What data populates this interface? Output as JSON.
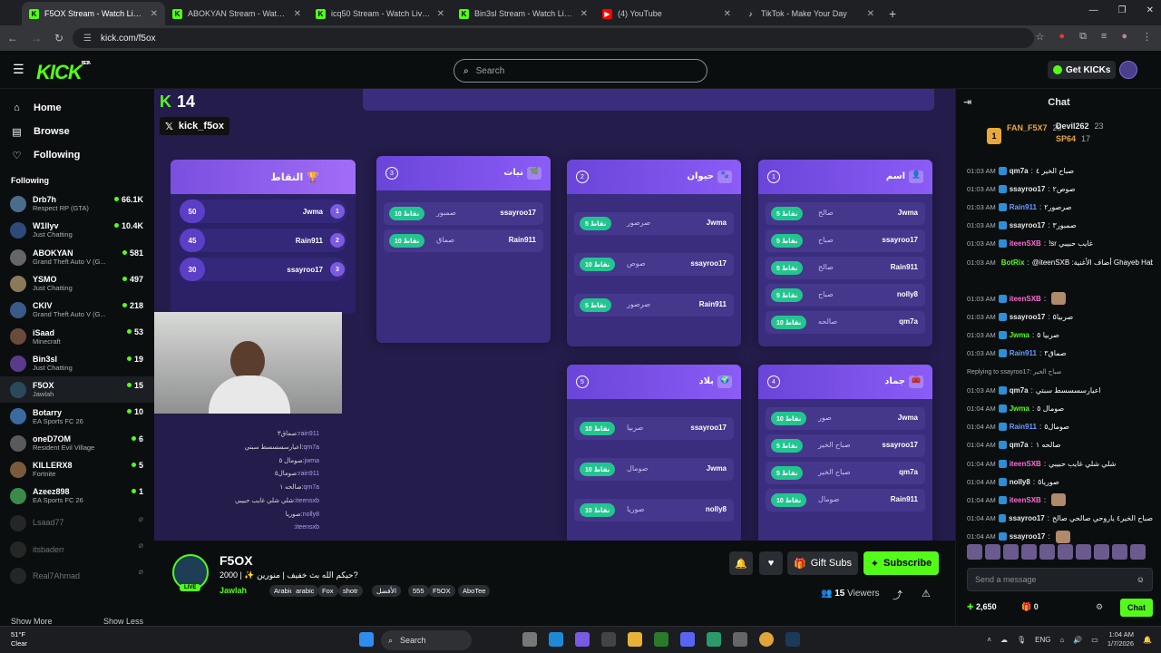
{
  "browser": {
    "tabs": [
      {
        "title": "F5OX Stream - Watch Live on K",
        "active": true,
        "favicon": "kick"
      },
      {
        "title": "ABOKYAN Stream - Watch Live",
        "favicon": "kick"
      },
      {
        "title": "icq50 Stream - Watch Live on K",
        "favicon": "kick"
      },
      {
        "title": "Bin3sl Stream - Watch Live on K",
        "favicon": "kick"
      },
      {
        "title": "(4) YouTube",
        "favicon": "youtube"
      },
      {
        "title": "TikTok - Make Your Day",
        "favicon": "tiktok"
      }
    ],
    "url": "kick.com/f5ox"
  },
  "header": {
    "logo": "KICK",
    "logo_sup": "BETA",
    "search_placeholder": "Search",
    "get_kicks": "Get KICKs"
  },
  "sidebar": {
    "nav": [
      {
        "label": "Home",
        "icon": "home-icon"
      },
      {
        "label": "Browse",
        "icon": "browse-icon"
      },
      {
        "label": "Following",
        "icon": "heart-icon"
      }
    ],
    "section_title": "Following",
    "channels": [
      {
        "name": "Drb7h",
        "category": "Respect RP (GTA)",
        "viewers": "66.1K",
        "color": "#4a6d8c"
      },
      {
        "name": "W1llyv",
        "category": "Just Chatting",
        "viewers": "10.4K",
        "color": "#2e4a7a"
      },
      {
        "name": "ABOKYAN",
        "category": "Grand Theft Auto V (G...",
        "viewers": "581",
        "color": "#666"
      },
      {
        "name": "YSMO",
        "category": "Just Chatting",
        "viewers": "497",
        "color": "#8a7a5a"
      },
      {
        "name": "CKIV",
        "category": "Grand Theft Auto V (G...",
        "viewers": "218",
        "color": "#3a5a8a"
      },
      {
        "name": "iSaad",
        "category": "Minecraft",
        "viewers": "53",
        "color": "#6a4a3a"
      },
      {
        "name": "Bin3sl",
        "category": "Just Chatting",
        "viewers": "19",
        "color": "#5a3a8a"
      },
      {
        "name": "F5OX",
        "category": "Jawlah",
        "viewers": "15",
        "color": "#2a4a5a",
        "selected": true
      },
      {
        "name": "Botarry",
        "category": "EA Sports FC 26",
        "viewers": "10",
        "color": "#3a6aa0"
      },
      {
        "name": "oneD7OM",
        "category": "Resident Evil Village",
        "viewers": "6",
        "color": "#5a5a5a"
      },
      {
        "name": "KILLERX8",
        "category": "Fortnite",
        "viewers": "5",
        "color": "#7a5a3a"
      },
      {
        "name": "Azeez898",
        "category": "EA Sports FC 26",
        "viewers": "1",
        "color": "#3a8a4a"
      },
      {
        "name": "Lsaad77",
        "category": "",
        "viewers": "",
        "color": "#555",
        "offline": true
      },
      {
        "name": "itsbaderr",
        "category": "",
        "viewers": "",
        "color": "#555",
        "offline": true
      },
      {
        "name": "Real7Ahmad",
        "category": "",
        "viewers": "",
        "color": "#555",
        "offline": true
      }
    ],
    "show_more": "Show More",
    "show_less": "Show Less"
  },
  "stream": {
    "kick_count": "14",
    "x_handle": "kick_f5ox",
    "score_title": "النقاط",
    "scores": [
      {
        "points": "50",
        "name": "Jwma",
        "rank": "1"
      },
      {
        "points": "45",
        "name": "Rain911",
        "rank": "2"
      },
      {
        "points": "30",
        "name": "ssayroo17",
        "rank": "3"
      }
    ],
    "cards": [
      {
        "num": "3",
        "title": "نبات",
        "rows": [
          {
            "pts": "10 نقاط",
            "ans": "صمبور",
            "player": "ssayroo17"
          },
          {
            "pts": "10 نقاط",
            "ans": "صماق",
            "player": "Rain911"
          }
        ]
      },
      {
        "num": "2",
        "title": "حيوان",
        "rows": [
          {
            "pts": "5 نقاط",
            "ans": "صرصور",
            "player": "Jwma"
          },
          {
            "pts": "10 نقاط",
            "ans": "صوص",
            "player": "ssayroo17"
          },
          {
            "pts": "5 نقاط",
            "ans": "صرصور",
            "player": "Rain911"
          }
        ]
      },
      {
        "num": "1",
        "title": "اسم",
        "rows": [
          {
            "pts": "5 نقاط",
            "ans": "صالح",
            "player": "Jwma"
          },
          {
            "pts": "5 نقاط",
            "ans": "صباح",
            "player": "ssayroo17"
          },
          {
            "pts": "5 نقاط",
            "ans": "صالح",
            "player": "Rain911"
          },
          {
            "pts": "5 نقاط",
            "ans": "صباح",
            "player": "nolly8"
          },
          {
            "pts": "10 نقاط",
            "ans": "صالحه",
            "player": "qm7a"
          }
        ]
      },
      {
        "num": "5",
        "title": "بلاد",
        "rows": [
          {
            "pts": "10 نقاط",
            "ans": "صربيا",
            "player": "ssayroo17"
          },
          {
            "pts": "10 نقاط",
            "ans": "صومال",
            "player": "Jwma"
          },
          {
            "pts": "10 نقاط",
            "ans": "صوريا",
            "player": "nolly8"
          }
        ]
      },
      {
        "num": "4",
        "title": "جماد",
        "rows": [
          {
            "pts": "10 نقاط",
            "ans": "صور",
            "player": "Jwma"
          },
          {
            "pts": "5 نقاط",
            "ans": "صباح الخير",
            "player": "ssayroo17"
          },
          {
            "pts": "5 نقاط",
            "ans": "صباح الخير",
            "player": "qm7a"
          },
          {
            "pts": "10 نقاط",
            "ans": "صومال",
            "player": "Rain911"
          }
        ]
      }
    ],
    "overlay_chat": [
      {
        "user": "rain911",
        "text": "صماق٣"
      },
      {
        "user": "qm7a",
        "text": "اعيارسسسسط سبتي"
      },
      {
        "user": "jwma",
        "text": "صومال ٥"
      },
      {
        "user": "rain911",
        "text": "صومال٥"
      },
      {
        "user": "qm7a",
        "text": "صالحه ١"
      },
      {
        "user": "iteensxb",
        "text": "شلي شلي غايب حبيبي"
      },
      {
        "user": "nolly8",
        "text": "صوريا"
      },
      {
        "user": "iteensxb",
        "text": ""
      }
    ]
  },
  "info": {
    "channel": "F5OX",
    "live": "LIVE",
    "title": "حيكم الله بث خفيف | منورين ✨ | 2000?",
    "category": "Jawlah",
    "tags": [
      "Arabic",
      "arabic",
      "Fox",
      "shotr",
      "الأفضل",
      "555",
      "F5OX",
      "AboTee"
    ],
    "gift_subs": "Gift Subs",
    "subscribe": "Subscribe",
    "viewers": "15",
    "viewers_label": "Viewers"
  },
  "chat": {
    "title": "Chat",
    "pinned": [
      {
        "name": "FAN_F5X7",
        "sub": "26",
        "color": "#e8a93a"
      },
      {
        "name": "Devil262",
        "sub": "23",
        "color": "#e8e8e8"
      },
      {
        "name": "SP64",
        "sub": "17",
        "color": "#e8a93a"
      }
    ],
    "messages": [
      {
        "time": "01:03 AM",
        "user": "qm7a",
        "color": "#e8e8e8",
        "text": "صباح الخير ٤"
      },
      {
        "time": "01:03 AM",
        "user": "ssayroo17",
        "color": "#e8e8e8",
        "text": "صوص٢"
      },
      {
        "time": "01:03 AM",
        "user": "Rain911",
        "color": "#6a9cff",
        "text": "صرصور٢"
      },
      {
        "time": "01:03 AM",
        "user": "ssayroo17",
        "color": "#e8e8e8",
        "text": "صمبور٣"
      },
      {
        "time": "01:03 AM",
        "user": "iteenSXB",
        "color": "#ff6ad5",
        "text": "!sr غايب حبيبي"
      },
      {
        "time": "01:03 AM",
        "user": "BotRix",
        "color": "#53fc18",
        "text": "@iteenSXB :أضاف الأغنية Ghayeb Habibi إلى قائمة التشغيل"
      },
      {
        "time": "",
        "user": "",
        "color": "#fff",
        "text": ""
      },
      {
        "time": "01:03 AM",
        "user": "iteenSXB",
        "color": "#ff6ad5",
        "text": ""
      },
      {
        "time": "01:03 AM",
        "user": "ssayroo17",
        "color": "#e8e8e8",
        "text": "صربيا٥"
      },
      {
        "time": "01:03 AM",
        "user": "Jwma",
        "color": "#53fc18",
        "text": "صربيا ٥"
      },
      {
        "time": "01:03 AM",
        "user": "Rain911",
        "color": "#6a9cff",
        "text": "صماق٣"
      },
      {
        "time": "",
        "user": "",
        "color": "#aaa",
        "text": "Replying to ssayroo17: صباح الخير"
      },
      {
        "time": "01:03 AM",
        "user": "qm7a",
        "color": "#e8e8e8",
        "text": "اعيارسسسسط سبتي"
      },
      {
        "time": "01:04 AM",
        "user": "Jwma",
        "color": "#53fc18",
        "text": "صومال ٥"
      },
      {
        "time": "01:04 AM",
        "user": "Rain911",
        "color": "#6a9cff",
        "text": "صومال٥"
      },
      {
        "time": "01:04 AM",
        "user": "qm7a",
        "color": "#e8e8e8",
        "text": "صالحه ١"
      },
      {
        "time": "01:04 AM",
        "user": "iteenSXB",
        "color": "#ff6ad5",
        "text": "شلي شلي غايب حبيبي"
      },
      {
        "time": "01:04 AM",
        "user": "nolly8",
        "color": "#e8e8e8",
        "text": "صوريا٥"
      },
      {
        "time": "01:04 AM",
        "user": "iteenSXB",
        "color": "#ff6ad5",
        "text": ""
      },
      {
        "time": "01:04 AM",
        "user": "ssayroo17",
        "color": "#e8e8e8",
        "text": "صباح الخير٤ ياروحي صالحي صالح"
      },
      {
        "time": "01:04 AM",
        "user": "ssayroo17",
        "color": "#e8e8e8",
        "text": ""
      }
    ],
    "send_placeholder": "Send a message",
    "kicks_balance": "2,650",
    "gifts": "0",
    "chat_button": "Chat"
  },
  "taskbar": {
    "temp": "51°F",
    "weather": "Clear",
    "search": "Search",
    "lang": "ENG",
    "time": "1:04 AM",
    "date": "1/7/2026"
  }
}
